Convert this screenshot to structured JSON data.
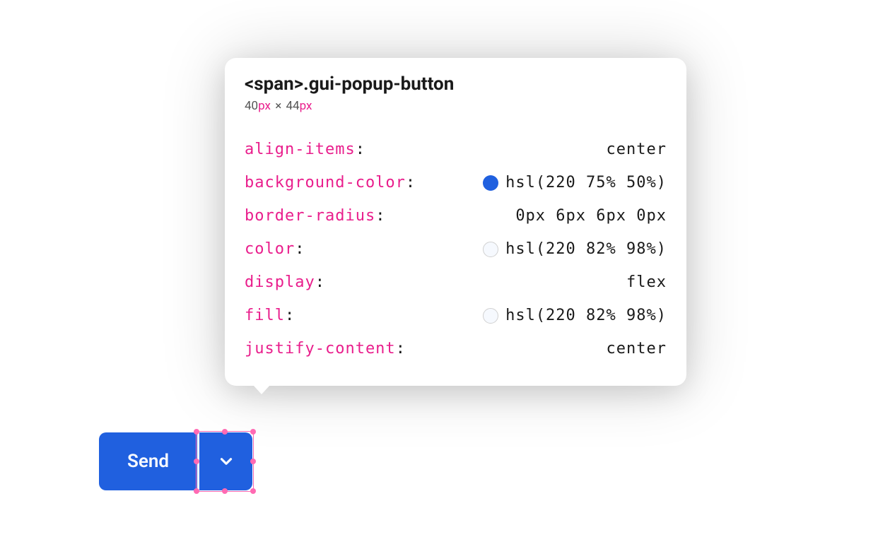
{
  "tooltip": {
    "selector_tag": "<span>",
    "selector_class": ".gui-popup-button",
    "width_value": "40",
    "width_unit": "px",
    "times": "×",
    "height_value": "44",
    "height_unit": "px",
    "props": [
      {
        "name": "align-items",
        "value": "center",
        "swatch": null
      },
      {
        "name": "background-color",
        "value": "hsl(220 75% 50%)",
        "swatch": "blue"
      },
      {
        "name": "border-radius",
        "value": "0px 6px 6px 0px",
        "swatch": null
      },
      {
        "name": "color",
        "value": "hsl(220 82% 98%)",
        "swatch": "white"
      },
      {
        "name": "display",
        "value": "flex",
        "swatch": null
      },
      {
        "name": "fill",
        "value": "hsl(220 82% 98%)",
        "swatch": "white"
      },
      {
        "name": "justify-content",
        "value": "center",
        "swatch": null
      }
    ]
  },
  "button": {
    "send_label": "Send"
  }
}
